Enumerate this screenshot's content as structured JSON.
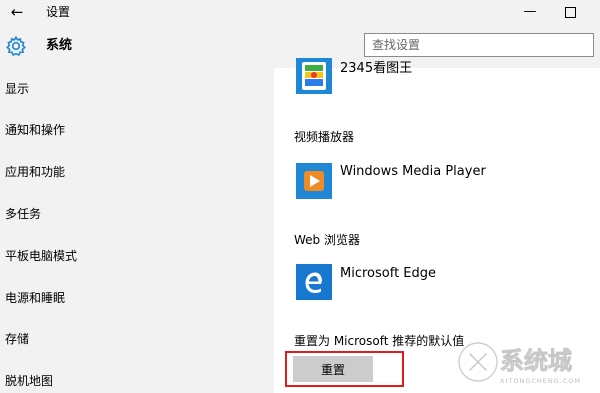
{
  "window": {
    "title": "设置",
    "back_icon": "←",
    "minimize_icon": "—"
  },
  "header": {
    "section_title": "系统",
    "search_placeholder": "查找设置",
    "icon": "gear-icon"
  },
  "sidebar": {
    "items": [
      {
        "label": "显示"
      },
      {
        "label": "通知和操作"
      },
      {
        "label": "应用和功能"
      },
      {
        "label": "多任务"
      },
      {
        "label": "平板电脑模式"
      },
      {
        "label": "电源和睡眠"
      },
      {
        "label": "存储"
      },
      {
        "label": "脱机地图"
      }
    ]
  },
  "main": {
    "photo_app": {
      "name": "2345看图王"
    },
    "video_player": {
      "label": "视频播放器",
      "app_name": "Windows Media Player"
    },
    "web_browser": {
      "label": "Web 浏览器",
      "app_name": "Microsoft Edge"
    },
    "reset": {
      "label": "重置为 Microsoft 推荐的默认值",
      "button": "重置"
    }
  },
  "watermark": {
    "text": "系统城",
    "subtext": "XITONGCHENG.COM"
  },
  "colors": {
    "accent": "#1e88d7",
    "sidebar_bg": "#f2f2f2",
    "button_bg": "#cccccc",
    "highlight": "#e01c1c",
    "wmp_orange": "#f08a24",
    "edge_blue": "#1877cf"
  }
}
